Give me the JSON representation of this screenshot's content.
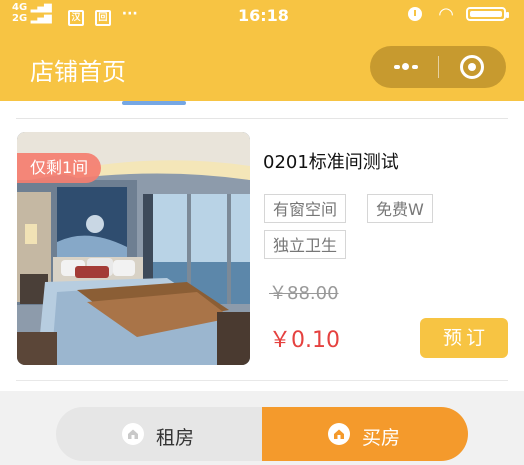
{
  "status_bar": {
    "network_top": "4G",
    "network_bottom": "2G",
    "icon_left_1": "汉",
    "icon_left_2": "回",
    "dots": "···",
    "time": "16:18"
  },
  "header": {
    "title": "店铺首页",
    "more_icon": "more-dots-icon",
    "close_icon": "target-circle-icon"
  },
  "listing": {
    "badge": "仅剩1间",
    "name": "0201标准间测试",
    "tags": [
      "有窗空间",
      "免费W",
      "独立卫生"
    ],
    "original_price": "￥88.00",
    "price": "￥0.10",
    "book_label": "预订"
  },
  "segment": {
    "rent_label": "租房",
    "buy_label": "买房",
    "active": "买房"
  },
  "colors": {
    "brand_yellow": "#f7c443",
    "active_orange": "#f49a2c",
    "price_red": "#e5413f",
    "badge_coral": "#f47e70"
  }
}
